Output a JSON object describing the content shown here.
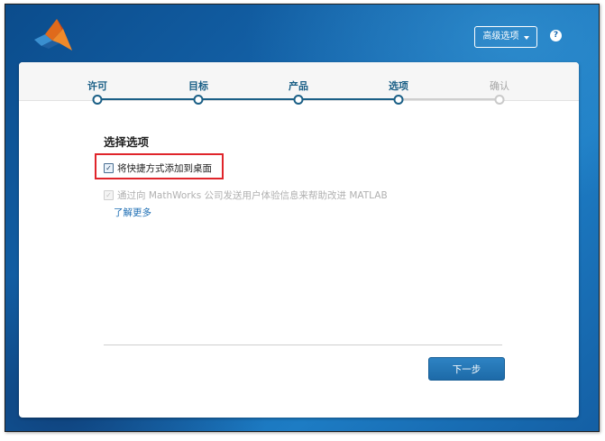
{
  "header": {
    "logo_icon": "matlab-membrane-logo",
    "advanced_button_label": "高级选项",
    "help_label": "?",
    "colors": {
      "background": "#1668b0",
      "accent": "#1a5f86",
      "highlight": "#e0252b"
    }
  },
  "steps": [
    {
      "label": "许可",
      "state": "done"
    },
    {
      "label": "目标",
      "state": "done"
    },
    {
      "label": "产品",
      "state": "done"
    },
    {
      "label": "选项",
      "state": "current"
    },
    {
      "label": "确认",
      "state": "pending"
    }
  ],
  "main": {
    "section_title": "选择选项",
    "options": [
      {
        "label": "将快捷方式添加到桌面",
        "checked": true,
        "enabled": true
      },
      {
        "label": "通过向 MathWorks 公司发送用户体验信息来帮助改进 MATLAB",
        "checked": true,
        "enabled": false
      }
    ],
    "learn_more_label": "了解更多"
  },
  "footer": {
    "next_button_label": "下一步"
  }
}
